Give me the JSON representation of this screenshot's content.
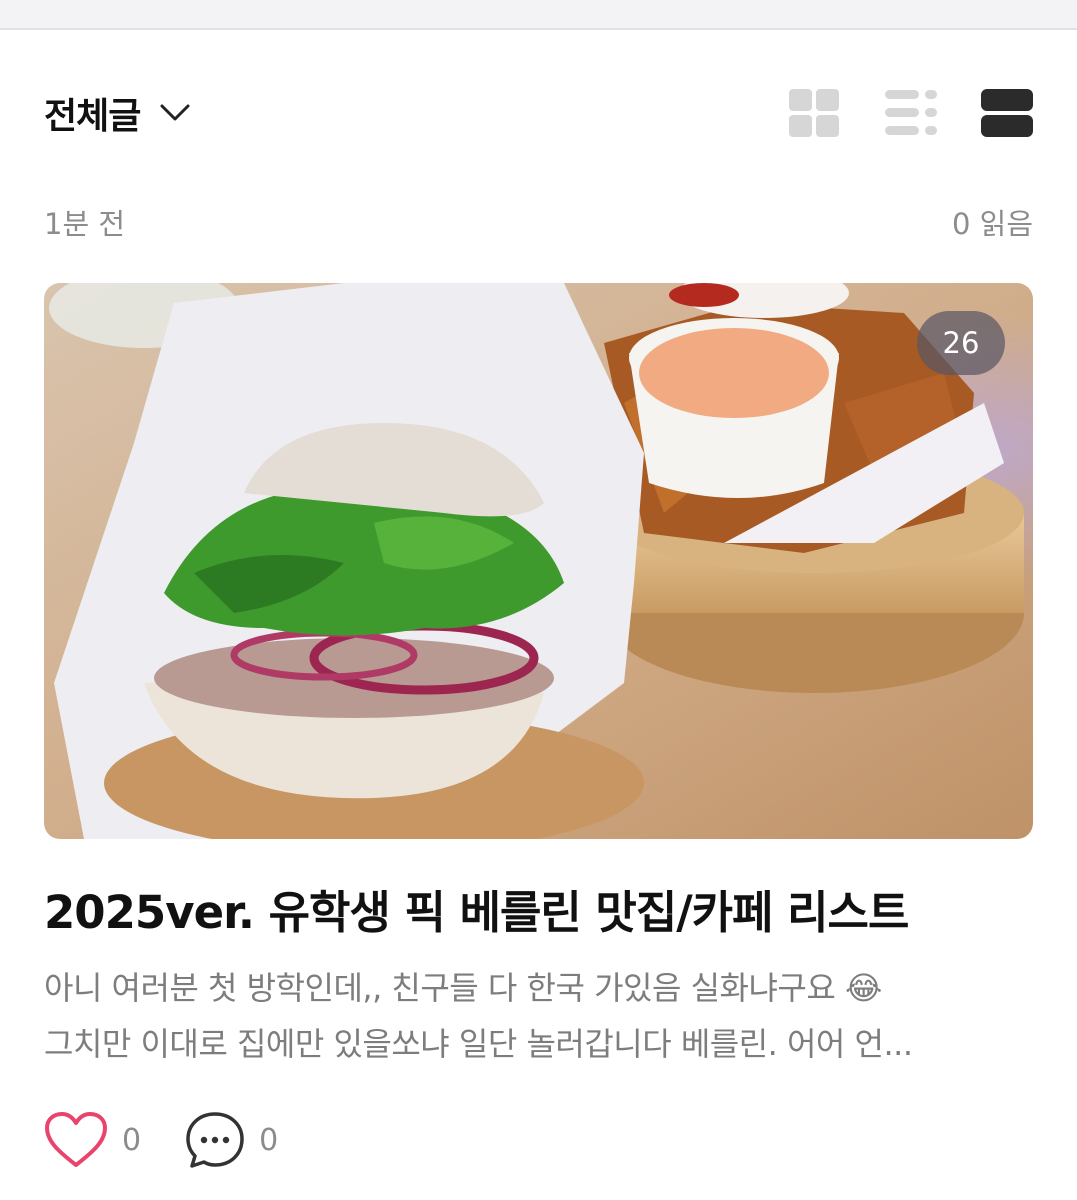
{
  "header": {
    "category_title": "전체글",
    "view_modes": [
      "grid-view",
      "list-view",
      "card-view"
    ],
    "active_view": "card-view"
  },
  "post": {
    "time_ago": "1분 전",
    "read_count": "0 읽음",
    "photo_count": "26",
    "title": "2025ver. 유학생 픽 베를린 맛집/카페 리스트",
    "excerpt_line1": "아니 여러분 첫 방학인데,, 친구들 다 한국 가있음 실화냐구요 😂",
    "excerpt_line2": "그치만 이대로 집에만 있을쏘냐 일단 놀러갑니다 베를린. 어어 언...",
    "like_count": "0",
    "comment_count": "0"
  },
  "colors": {
    "like_icon": "#e8446d",
    "view_active": "#2b2b2b",
    "view_inactive": "#d6d6d6"
  }
}
